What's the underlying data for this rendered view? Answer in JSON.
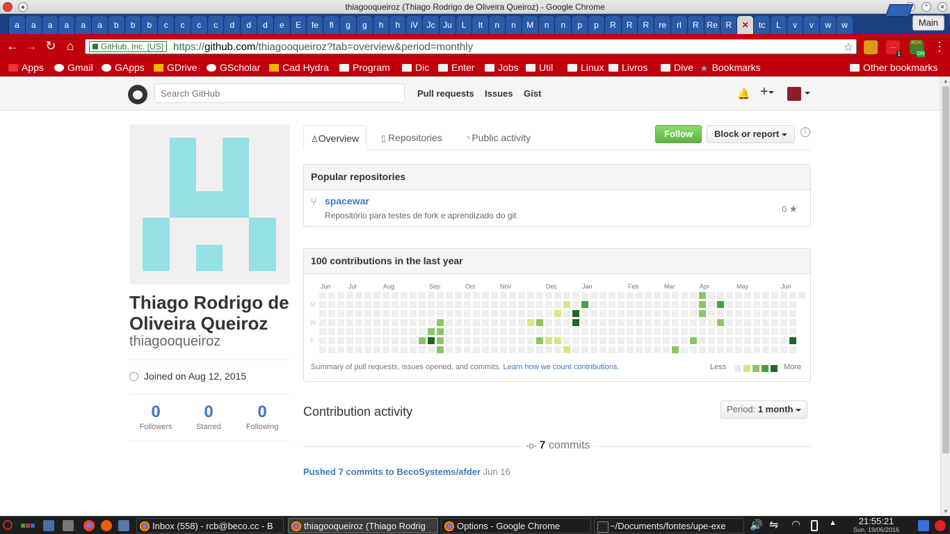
{
  "window": {
    "title": "thiagooqueiroz (Thiago Rodrigo de Oliveira Queiroz) - Google Chrome"
  },
  "tabs": [
    "a",
    "a",
    "a",
    "a",
    "a",
    "a",
    "b",
    "b",
    "b",
    "c",
    "c",
    "c",
    "c",
    "d",
    "d",
    "d",
    "e",
    "E",
    "fe",
    "fl",
    "g",
    "g",
    "h",
    "h",
    "iV",
    "Jc",
    "Ju",
    "L",
    "It",
    "n",
    "n",
    "M",
    "n",
    "n",
    "p",
    "p",
    "R",
    "R",
    "R",
    "re",
    "rl",
    "R",
    "Re",
    "R",
    "",
    "tc",
    "L",
    "v",
    "v",
    "w",
    "w"
  ],
  "tab_close": "✕",
  "window_label": "Main",
  "omnibox": {
    "ev_label": "GitHub, Inc. [US]",
    "scheme": "https://",
    "host": "github.com",
    "path": "/thiagooqueiroz?tab=overview&period=monthly"
  },
  "bookmarks": [
    {
      "label": "Apps",
      "icon": "apps-grid-icon"
    },
    {
      "label": "Gmail",
      "icon": "gmail-icon"
    },
    {
      "label": "GApps",
      "icon": "google-icon"
    },
    {
      "label": "GDrive",
      "icon": "drive-icon"
    },
    {
      "label": "GScholar",
      "icon": "scholar-icon"
    },
    {
      "label": "Cad Hydra",
      "icon": "drive-icon"
    },
    {
      "label": "Program",
      "icon": "folder-icon"
    },
    {
      "label": "Dic",
      "icon": "folder-icon"
    },
    {
      "label": "Enter",
      "icon": "folder-icon"
    },
    {
      "label": "Jobs",
      "icon": "folder-icon"
    },
    {
      "label": "Util",
      "icon": "folder-icon"
    },
    {
      "label": "Linux",
      "icon": "folder-icon"
    },
    {
      "label": "Livros",
      "icon": "folder-icon"
    },
    {
      "label": "Dive",
      "icon": "folder-icon"
    },
    {
      "label": "Bookmarks",
      "icon": "star-icon"
    }
  ],
  "other_bookmarks": "Other bookmarks",
  "extensions": {
    "badge1": "1",
    "badge2": "ON",
    "badge2_top": "BOX"
  },
  "gh_header": {
    "search_placeholder": "Search GitHub",
    "nav": [
      "Pull requests",
      "Issues",
      "Gist"
    ]
  },
  "profile": {
    "fullname": "Thiago Rodrigo de Oliveira Queiroz",
    "username": "thiagooqueiroz",
    "joined": "Joined on Aug 12, 2015",
    "stats": [
      {
        "num": "0",
        "label": "Followers"
      },
      {
        "num": "0",
        "label": "Starred"
      },
      {
        "num": "0",
        "label": "Following"
      }
    ]
  },
  "profile_tabs": [
    "Overview",
    "Repositories",
    "Public activity"
  ],
  "buttons": {
    "follow": "Follow",
    "block": "Block or report",
    "info": "i"
  },
  "popular": {
    "title": "Popular repositories",
    "repo": {
      "name": "spacewar",
      "description": "Repositório para testes de fork e aprendizado do git",
      "stars": "0"
    }
  },
  "calendar": {
    "title": "100 contributions in the last year",
    "months": [
      "Jun",
      "Jul",
      "Aug",
      "Sep",
      "Oct",
      "Nov",
      "Dec",
      "Jan",
      "Feb",
      "Mar",
      "Apr",
      "May",
      "Jun"
    ],
    "days": [
      "M",
      "W",
      "F"
    ],
    "summary": "Summary of pull requests, issues opened, and commits.",
    "learn_link": "Learn how we count contributions.",
    "less": "Less",
    "more": "More",
    "colors": [
      "#eeeeee",
      "#d6e685",
      "#8cc665",
      "#44a340",
      "#1e6823"
    ],
    "active_cells": [
      {
        "week": 11,
        "day": 5,
        "level": 2
      },
      {
        "week": 12,
        "day": 4,
        "level": 2
      },
      {
        "week": 12,
        "day": 5,
        "level": 4
      },
      {
        "week": 13,
        "day": 3,
        "level": 2
      },
      {
        "week": 13,
        "day": 4,
        "level": 2
      },
      {
        "week": 13,
        "day": 5,
        "level": 2
      },
      {
        "week": 13,
        "day": 6,
        "level": 2
      },
      {
        "week": 23,
        "day": 3,
        "level": 1
      },
      {
        "week": 24,
        "day": 3,
        "level": 2
      },
      {
        "week": 24,
        "day": 5,
        "level": 2
      },
      {
        "week": 25,
        "day": 5,
        "level": 1
      },
      {
        "week": 26,
        "day": 2,
        "level": 1
      },
      {
        "week": 26,
        "day": 5,
        "level": 1
      },
      {
        "week": 27,
        "day": 1,
        "level": 1
      },
      {
        "week": 27,
        "day": 6,
        "level": 1
      },
      {
        "week": 28,
        "day": 2,
        "level": 4
      },
      {
        "week": 28,
        "day": 3,
        "level": 4
      },
      {
        "week": 29,
        "day": 1,
        "level": 3
      },
      {
        "week": 39,
        "day": 6,
        "level": 2
      },
      {
        "week": 41,
        "day": 5,
        "level": 2
      },
      {
        "week": 41,
        "day": 7,
        "level": 1
      },
      {
        "week": 42,
        "day": 0,
        "level": 2
      },
      {
        "week": 42,
        "day": 1,
        "level": 2
      },
      {
        "week": 42,
        "day": 2,
        "level": 2
      },
      {
        "week": 43,
        "day": 7,
        "level": 3
      },
      {
        "week": 44,
        "day": 1,
        "level": 3
      },
      {
        "week": 44,
        "day": 3,
        "level": 2
      },
      {
        "week": 46,
        "day": 7,
        "level": 1
      },
      {
        "week": 52,
        "day": 5,
        "level": 4
      }
    ]
  },
  "activity": {
    "title": "Contribution activity",
    "period_label": "Period:",
    "period_value": "1 month",
    "commit_count": "7",
    "commit_word": "commits",
    "pushed_link": "Pushed 7 commits to BecoSystems/afder",
    "pushed_date": "Jun 16"
  },
  "taskbar": {
    "tasks": [
      {
        "label": "Inbox (558) - rcb@beco.cc - B",
        "active": false
      },
      {
        "label": "thiagooqueiroz (Thiago Rodrig",
        "active": true
      },
      {
        "label": "Options - Google Chrome",
        "active": false
      },
      {
        "label": "~/Documents/fontes/upe-exe",
        "active": false
      }
    ],
    "time": "21:55:21",
    "date": "Sun, 19/06/2016"
  }
}
